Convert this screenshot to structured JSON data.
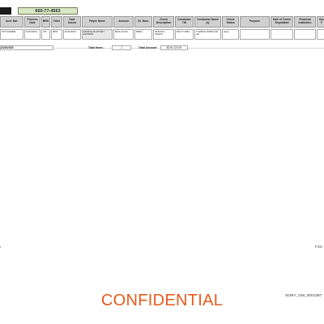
{
  "header": {
    "ssn_value": "660-77-4563"
  },
  "columns": [
    "Acct. Bal.",
    "Process Date",
    "BRN",
    "Teller",
    "Date Issued",
    "Payee Name",
    "Amount",
    "Ck. Num.",
    "Check Description",
    "Conductor TIN",
    "Conductor Name (s)",
    "Check Status",
    "Purpose",
    "Date of Check Negotiated",
    "Financial Institution",
    "Sou F"
  ],
  "rows": [
    [
      "0TTI DAMIER",
      "12/01/2014",
      "731",
      "9800",
      "12/01/2014",
      "ESTATE OF WYNET EPSTEIN",
      "$216,124.09",
      "98902",
      "OFFICIAL CHECK",
      "660-77-4563",
      "THOMAS NOBLE OR ALI",
      "Issue",
      "",
      "",
      "",
      ""
    ]
  ],
  "summary": {
    "date": "2/28/2025",
    "total_items_label": "Total Items",
    "total_items": "1",
    "total_amount_label": "Total Amount",
    "total_amount": "$216,124.09"
  },
  "footer": {
    "left_text": "r",
    "right_text": "First",
    "confidential": "CONFIDENTIAL",
    "bates": "SONY_GM_0001387"
  }
}
